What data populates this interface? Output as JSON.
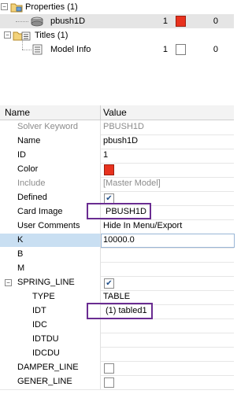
{
  "tree": {
    "properties_label": "Properties (1)",
    "pbush_label": "pbush1D",
    "pbush_id": "1",
    "pbush_count": "0",
    "titles_label": "Titles (1)",
    "model_info_label": "Model Info",
    "model_info_id": "1",
    "model_info_count": "0"
  },
  "grid": {
    "header_name": "Name",
    "header_value": "Value",
    "rows": [
      {
        "name": "Solver Keyword",
        "value": "PBUSH1D"
      },
      {
        "name": "Name",
        "value": "pbush1D"
      },
      {
        "name": "ID",
        "value": "1"
      },
      {
        "name": "Color",
        "value": ""
      },
      {
        "name": "Include",
        "value": "[Master Model]"
      },
      {
        "name": "Defined",
        "value": "checked"
      },
      {
        "name": "Card Image",
        "value": "PBUSH1D"
      },
      {
        "name": "User Comments",
        "value": "Hide In Menu/Export"
      },
      {
        "name": "K",
        "value": "10000.0"
      },
      {
        "name": "B",
        "value": ""
      },
      {
        "name": "M",
        "value": ""
      },
      {
        "name": "SPRING_LINE",
        "value": "checked"
      },
      {
        "name": "TYPE",
        "value": "TABLE"
      },
      {
        "name": "IDT",
        "value": "(1) tabled1"
      },
      {
        "name": "IDC",
        "value": ""
      },
      {
        "name": "IDTDU",
        "value": ""
      },
      {
        "name": "IDCDU",
        "value": ""
      },
      {
        "name": "DAMPER_LINE",
        "value": "unchecked"
      },
      {
        "name": "GENER_LINE",
        "value": "unchecked"
      }
    ]
  },
  "colors": {
    "accent_red": "#e8321e",
    "highlight_row": "#c9dff2",
    "callout": "#6a2c91"
  }
}
